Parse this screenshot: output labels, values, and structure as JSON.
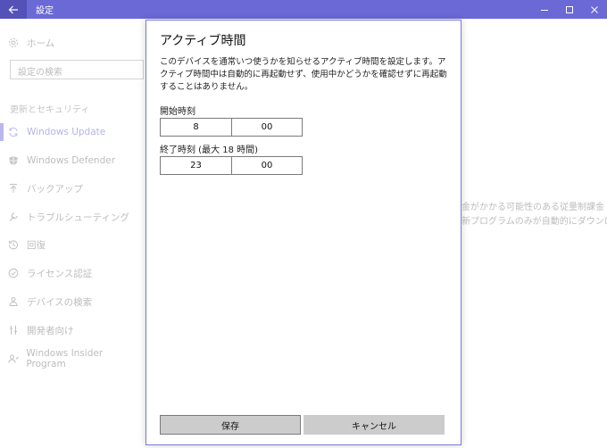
{
  "window": {
    "title": "設定",
    "back_icon": "arrow-left-icon",
    "controls": [
      "minimize-icon",
      "maximize-icon",
      "close-icon"
    ],
    "accent": "#6b69d6"
  },
  "nav": {
    "home": "ホーム",
    "search_placeholder": "設定の検索",
    "section": "更新とセキュリティ",
    "items": [
      {
        "label": "Windows Update",
        "icon": "sync-icon",
        "active": true
      },
      {
        "label": "Windows Defender",
        "icon": "shield-icon"
      },
      {
        "label": "バックアップ",
        "icon": "upload-arrow-icon"
      },
      {
        "label": "トラブルシューティング",
        "icon": "wrench-icon"
      },
      {
        "label": "回復",
        "icon": "history-icon"
      },
      {
        "label": "ライセンス認証",
        "icon": "check-circle-icon"
      },
      {
        "label": "デバイスの検索",
        "icon": "person-pin-icon"
      },
      {
        "label": "開発者向け",
        "icon": "developer-tools-icon"
      },
      {
        "label": "Windows Insider Program",
        "icon": "insider-icon"
      }
    ]
  },
  "background": {
    "line1": "金がかかる可能性のある従量制課金",
    "line2": "新プログラムのみが自動的にダウンロー"
  },
  "dialog": {
    "title": "アクティブ時間",
    "description": "このデバイスを通常いつ使うかを知らせるアクティブ時間を設定します。アクティブ時間中は自動的に再起動せず、使用中かどうかを確認せずに再起動することはありません。",
    "start": {
      "label": "開始時刻",
      "hour": "8",
      "minute": "00"
    },
    "end": {
      "label": "終了時刻 (最大 18 時間)",
      "hour": "23",
      "minute": "00"
    },
    "save": "保存",
    "cancel": "キャンセル"
  }
}
